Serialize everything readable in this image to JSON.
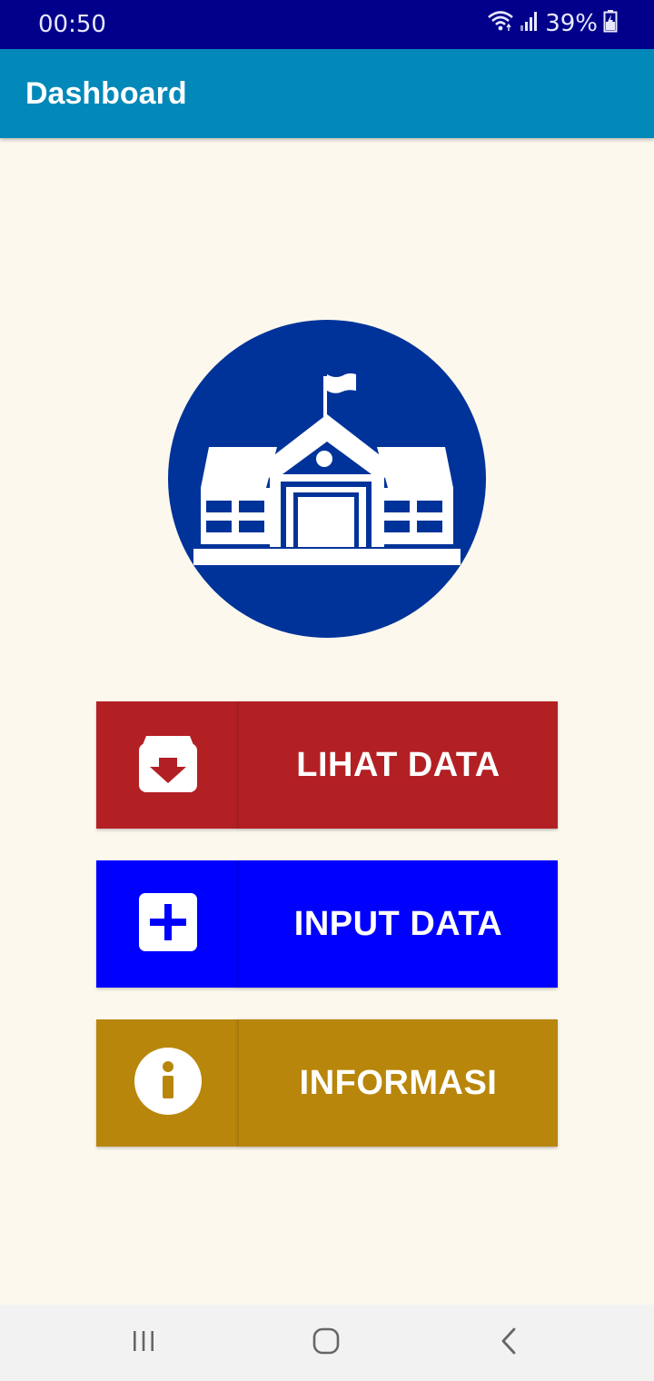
{
  "status_bar": {
    "time": "00:50",
    "battery": "39%",
    "icons": [
      "wifi-icon",
      "signal-icon",
      "battery-charging-icon"
    ]
  },
  "app_bar": {
    "title": "Dashboard",
    "color": "#0288b9"
  },
  "logo": {
    "icon": "school-building-icon",
    "color": "#003399"
  },
  "menu": [
    {
      "label": "LIHAT DATA",
      "icon": "archive-download-icon",
      "color": "#b32024"
    },
    {
      "label": "INPUT DATA",
      "icon": "add-box-icon",
      "color": "#0000ff"
    },
    {
      "label": "INFORMASI",
      "icon": "info-icon",
      "color": "#b8860b"
    }
  ],
  "nav_bar": {
    "items": [
      "recent-apps-icon",
      "home-icon",
      "back-icon"
    ]
  }
}
